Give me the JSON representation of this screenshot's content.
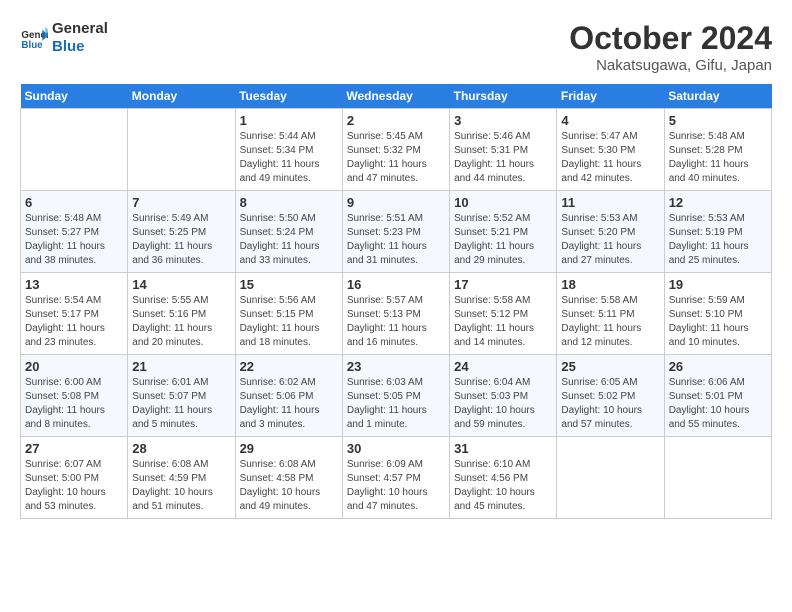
{
  "header": {
    "logo_general": "General",
    "logo_blue": "Blue",
    "month_title": "October 2024",
    "location": "Nakatsugawa, Gifu, Japan"
  },
  "weekdays": [
    "Sunday",
    "Monday",
    "Tuesday",
    "Wednesday",
    "Thursday",
    "Friday",
    "Saturday"
  ],
  "weeks": [
    [
      {
        "day": "",
        "sunrise": "",
        "sunset": "",
        "daylight": ""
      },
      {
        "day": "",
        "sunrise": "",
        "sunset": "",
        "daylight": ""
      },
      {
        "day": "1",
        "sunrise": "Sunrise: 5:44 AM",
        "sunset": "Sunset: 5:34 PM",
        "daylight": "Daylight: 11 hours and 49 minutes."
      },
      {
        "day": "2",
        "sunrise": "Sunrise: 5:45 AM",
        "sunset": "Sunset: 5:32 PM",
        "daylight": "Daylight: 11 hours and 47 minutes."
      },
      {
        "day": "3",
        "sunrise": "Sunrise: 5:46 AM",
        "sunset": "Sunset: 5:31 PM",
        "daylight": "Daylight: 11 hours and 44 minutes."
      },
      {
        "day": "4",
        "sunrise": "Sunrise: 5:47 AM",
        "sunset": "Sunset: 5:30 PM",
        "daylight": "Daylight: 11 hours and 42 minutes."
      },
      {
        "day": "5",
        "sunrise": "Sunrise: 5:48 AM",
        "sunset": "Sunset: 5:28 PM",
        "daylight": "Daylight: 11 hours and 40 minutes."
      }
    ],
    [
      {
        "day": "6",
        "sunrise": "Sunrise: 5:48 AM",
        "sunset": "Sunset: 5:27 PM",
        "daylight": "Daylight: 11 hours and 38 minutes."
      },
      {
        "day": "7",
        "sunrise": "Sunrise: 5:49 AM",
        "sunset": "Sunset: 5:25 PM",
        "daylight": "Daylight: 11 hours and 36 minutes."
      },
      {
        "day": "8",
        "sunrise": "Sunrise: 5:50 AM",
        "sunset": "Sunset: 5:24 PM",
        "daylight": "Daylight: 11 hours and 33 minutes."
      },
      {
        "day": "9",
        "sunrise": "Sunrise: 5:51 AM",
        "sunset": "Sunset: 5:23 PM",
        "daylight": "Daylight: 11 hours and 31 minutes."
      },
      {
        "day": "10",
        "sunrise": "Sunrise: 5:52 AM",
        "sunset": "Sunset: 5:21 PM",
        "daylight": "Daylight: 11 hours and 29 minutes."
      },
      {
        "day": "11",
        "sunrise": "Sunrise: 5:53 AM",
        "sunset": "Sunset: 5:20 PM",
        "daylight": "Daylight: 11 hours and 27 minutes."
      },
      {
        "day": "12",
        "sunrise": "Sunrise: 5:53 AM",
        "sunset": "Sunset: 5:19 PM",
        "daylight": "Daylight: 11 hours and 25 minutes."
      }
    ],
    [
      {
        "day": "13",
        "sunrise": "Sunrise: 5:54 AM",
        "sunset": "Sunset: 5:17 PM",
        "daylight": "Daylight: 11 hours and 23 minutes."
      },
      {
        "day": "14",
        "sunrise": "Sunrise: 5:55 AM",
        "sunset": "Sunset: 5:16 PM",
        "daylight": "Daylight: 11 hours and 20 minutes."
      },
      {
        "day": "15",
        "sunrise": "Sunrise: 5:56 AM",
        "sunset": "Sunset: 5:15 PM",
        "daylight": "Daylight: 11 hours and 18 minutes."
      },
      {
        "day": "16",
        "sunrise": "Sunrise: 5:57 AM",
        "sunset": "Sunset: 5:13 PM",
        "daylight": "Daylight: 11 hours and 16 minutes."
      },
      {
        "day": "17",
        "sunrise": "Sunrise: 5:58 AM",
        "sunset": "Sunset: 5:12 PM",
        "daylight": "Daylight: 11 hours and 14 minutes."
      },
      {
        "day": "18",
        "sunrise": "Sunrise: 5:58 AM",
        "sunset": "Sunset: 5:11 PM",
        "daylight": "Daylight: 11 hours and 12 minutes."
      },
      {
        "day": "19",
        "sunrise": "Sunrise: 5:59 AM",
        "sunset": "Sunset: 5:10 PM",
        "daylight": "Daylight: 11 hours and 10 minutes."
      }
    ],
    [
      {
        "day": "20",
        "sunrise": "Sunrise: 6:00 AM",
        "sunset": "Sunset: 5:08 PM",
        "daylight": "Daylight: 11 hours and 8 minutes."
      },
      {
        "day": "21",
        "sunrise": "Sunrise: 6:01 AM",
        "sunset": "Sunset: 5:07 PM",
        "daylight": "Daylight: 11 hours and 5 minutes."
      },
      {
        "day": "22",
        "sunrise": "Sunrise: 6:02 AM",
        "sunset": "Sunset: 5:06 PM",
        "daylight": "Daylight: 11 hours and 3 minutes."
      },
      {
        "day": "23",
        "sunrise": "Sunrise: 6:03 AM",
        "sunset": "Sunset: 5:05 PM",
        "daylight": "Daylight: 11 hours and 1 minute."
      },
      {
        "day": "24",
        "sunrise": "Sunrise: 6:04 AM",
        "sunset": "Sunset: 5:03 PM",
        "daylight": "Daylight: 10 hours and 59 minutes."
      },
      {
        "day": "25",
        "sunrise": "Sunrise: 6:05 AM",
        "sunset": "Sunset: 5:02 PM",
        "daylight": "Daylight: 10 hours and 57 minutes."
      },
      {
        "day": "26",
        "sunrise": "Sunrise: 6:06 AM",
        "sunset": "Sunset: 5:01 PM",
        "daylight": "Daylight: 10 hours and 55 minutes."
      }
    ],
    [
      {
        "day": "27",
        "sunrise": "Sunrise: 6:07 AM",
        "sunset": "Sunset: 5:00 PM",
        "daylight": "Daylight: 10 hours and 53 minutes."
      },
      {
        "day": "28",
        "sunrise": "Sunrise: 6:08 AM",
        "sunset": "Sunset: 4:59 PM",
        "daylight": "Daylight: 10 hours and 51 minutes."
      },
      {
        "day": "29",
        "sunrise": "Sunrise: 6:08 AM",
        "sunset": "Sunset: 4:58 PM",
        "daylight": "Daylight: 10 hours and 49 minutes."
      },
      {
        "day": "30",
        "sunrise": "Sunrise: 6:09 AM",
        "sunset": "Sunset: 4:57 PM",
        "daylight": "Daylight: 10 hours and 47 minutes."
      },
      {
        "day": "31",
        "sunrise": "Sunrise: 6:10 AM",
        "sunset": "Sunset: 4:56 PM",
        "daylight": "Daylight: 10 hours and 45 minutes."
      },
      {
        "day": "",
        "sunrise": "",
        "sunset": "",
        "daylight": ""
      },
      {
        "day": "",
        "sunrise": "",
        "sunset": "",
        "daylight": ""
      }
    ]
  ]
}
